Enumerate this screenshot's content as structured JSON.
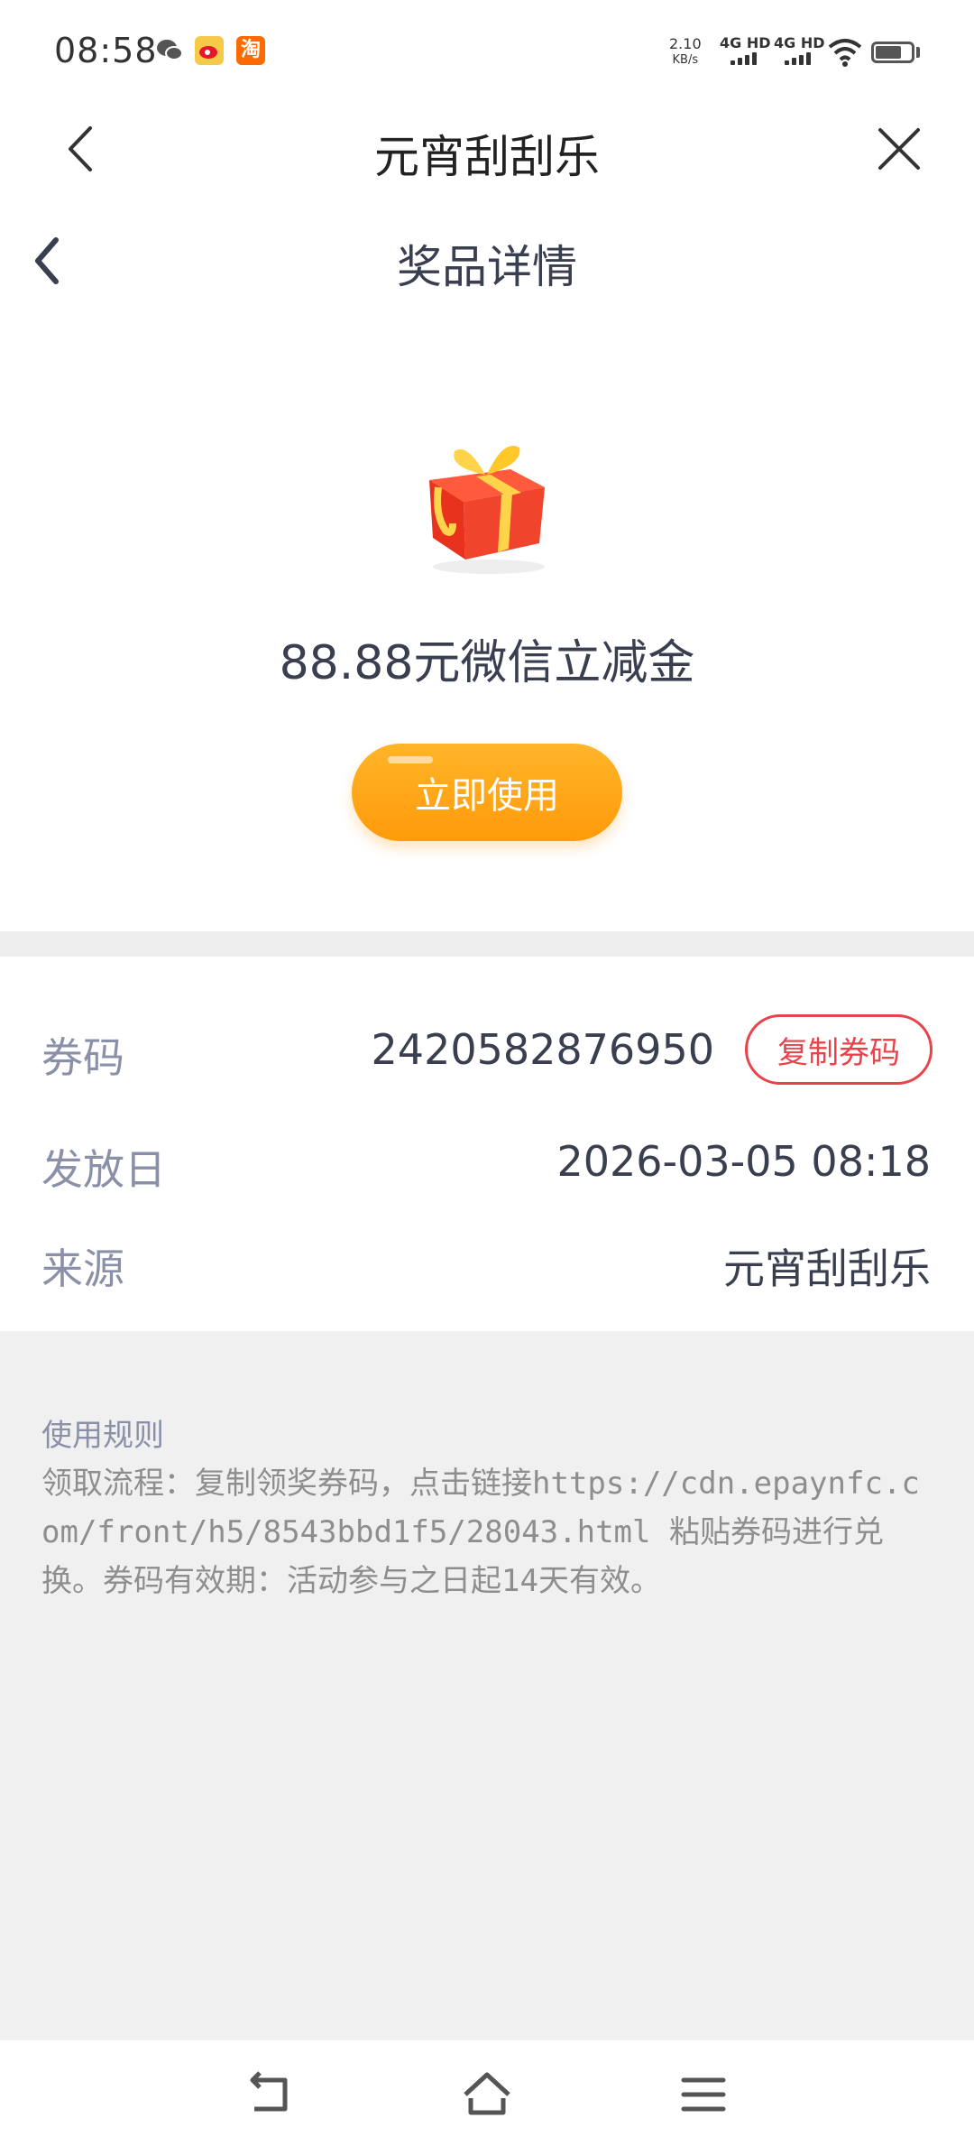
{
  "status_bar": {
    "time": "08:58",
    "speed_value": "2.10",
    "speed_unit": "KB/s",
    "network_1": "4G HD",
    "network_2": "4G HD",
    "taobao_label": "淘"
  },
  "nav": {
    "title": "元宵刮刮乐"
  },
  "sub_header": {
    "title": "奖品详情"
  },
  "prize": {
    "name": "88.88元微信立减金",
    "use_button_label": "立即使用"
  },
  "info": {
    "code_label": "券码",
    "code_value": "2420582876950",
    "copy_button_label": "复制券码",
    "issue_date_label": "发放日",
    "issue_date_value": "2026-03-05 08:18",
    "source_label": "来源",
    "source_value": "元宵刮刮乐"
  },
  "rules": {
    "title": "使用规则",
    "text": "领取流程：复制领奖券码，点击链接https://cdn.epaynfc.com/front/h5/8543bbd1f5/28043.html  粘贴券码进行兑换。券码有效期：活动参与之日起14天有效。"
  },
  "bottom_nav": {
    "icons": [
      "back-icon",
      "home-icon",
      "menu-icon"
    ]
  }
}
